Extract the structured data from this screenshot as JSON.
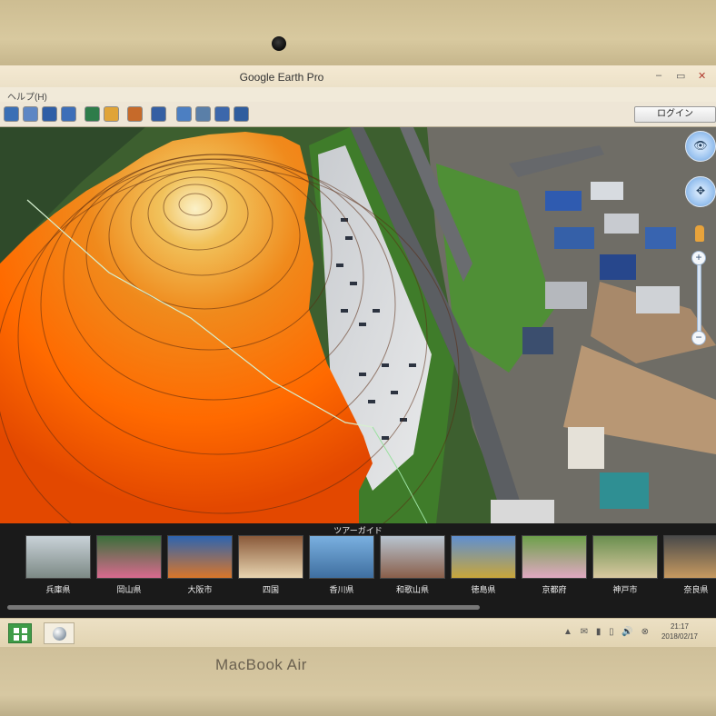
{
  "device": {
    "label": "MacBook Air"
  },
  "window": {
    "title": "Google Earth Pro",
    "controls": {
      "minimize": "–",
      "restore": "▭",
      "close": "✕"
    }
  },
  "menu": {
    "help": "ヘルプ(H)"
  },
  "toolbar": {
    "icons": [
      "placemark-icon",
      "polygon-icon",
      "path-icon",
      "overlay-icon",
      "record-tour-icon",
      "sunlight-icon",
      "planets-icon",
      "ruler-icon",
      "email-icon",
      "print-icon",
      "save-image-icon",
      "maps-icon"
    ],
    "login_label": "ログイン"
  },
  "navigation": {
    "look_glyph": "👁",
    "move_glyph": "✥",
    "zoom_in": "+",
    "zoom_out": "−"
  },
  "tour_guide": {
    "header": "ツアーガイド",
    "items": [
      {
        "label": "兵庫県"
      },
      {
        "label": "岡山県"
      },
      {
        "label": "大阪市"
      },
      {
        "label": "四国"
      },
      {
        "label": "香川県"
      },
      {
        "label": "和歌山県"
      },
      {
        "label": "徳島県"
      },
      {
        "label": "京都府"
      },
      {
        "label": "神戸市"
      },
      {
        "label": "奈良県"
      }
    ]
  },
  "taskbar": {
    "tray": "▲ ✉ ▮ ▯ 🔊 ⊗",
    "time": "21:17",
    "date": "2018/02/17"
  },
  "colors": {
    "terrain_hot": "#ff5a00",
    "terrain_mid": "#f08a1c",
    "terrain_peak": "#f6e6b8",
    "grass": "#4d8a34",
    "road": "#5b5e62",
    "taskbar": "#e6d9b8"
  }
}
